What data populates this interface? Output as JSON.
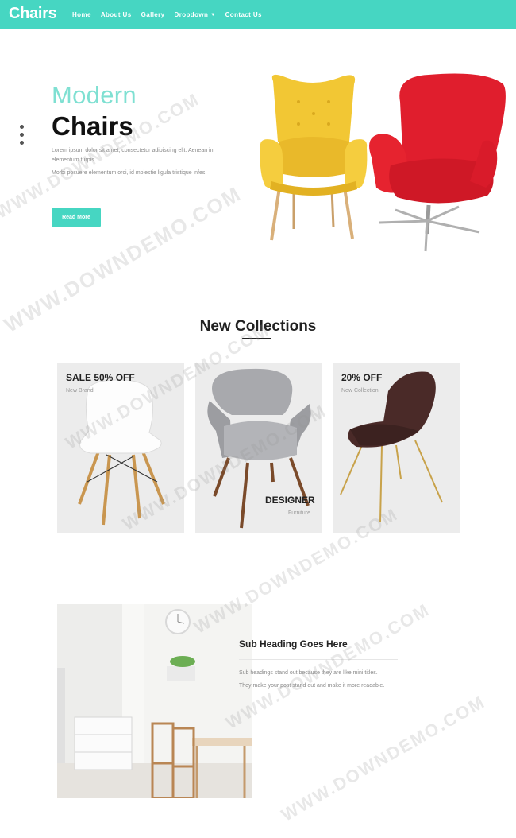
{
  "nav": {
    "brand": "Chairs",
    "items": [
      {
        "label": "Home"
      },
      {
        "label": "About Us"
      },
      {
        "label": "Gallery"
      },
      {
        "label": "Dropdown"
      },
      {
        "label": "Contact Us"
      }
    ]
  },
  "hero": {
    "subtitle": "Modern",
    "title": "Chairs",
    "paragraph1": "Lorem ipsum dolor sit amet, consectetur adipiscing elit. Aenean in elementum turpis.",
    "paragraph2": "Morbi posuere elementum orci, id molestie ligula tristique infes.",
    "button": "Read More"
  },
  "collections": {
    "title": "New Collections",
    "cards": [
      {
        "title": "SALE 50% OFF",
        "subtitle": "New Brand"
      },
      {
        "title": "DESIGNER",
        "subtitle": "Furniture"
      },
      {
        "title": "20% OFF",
        "subtitle": "New Collection"
      }
    ]
  },
  "feature": {
    "heading": "Sub Heading Goes Here",
    "line1": "Sub headings stand out because they are like mini titles.",
    "line2": "They make your post stand out and make it more readable."
  },
  "watermark": "WWW.DOWNDEMO.COM",
  "colors": {
    "accent": "#46d6c2",
    "yellow_chair": "#f2c734",
    "red_chair": "#e01e2d"
  }
}
